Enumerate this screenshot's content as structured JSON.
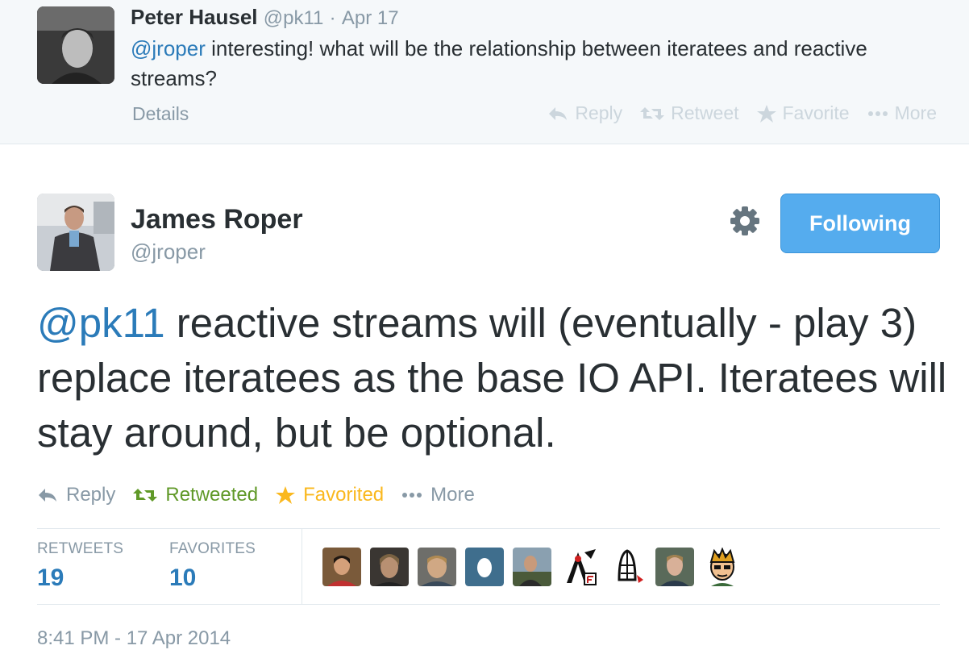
{
  "reply_tweet": {
    "name": "Peter Hausel",
    "handle": "@pk11",
    "separator": "·",
    "date": "Apr 17",
    "mention": "@jroper",
    "text": " interesting! what will be the relationship between iteratees and reactive streams?",
    "details_label": "Details",
    "actions": {
      "reply": "Reply",
      "retweet": "Retweet",
      "favorite": "Favorite",
      "more": "More"
    }
  },
  "main_tweet": {
    "name": "James Roper",
    "handle": "@jroper",
    "follow_label": "Following",
    "mention": "@pk11",
    "text": " reactive streams will (eventually - play 3) replace iteratees as the base IO API. Iteratees will stay around, but be optional.",
    "actions": {
      "reply": "Reply",
      "retweeted": "Retweeted",
      "favorited": "Favorited",
      "more": "More"
    },
    "stats": {
      "retweets_label": "RETWEETS",
      "retweets_count": "19",
      "favorites_label": "FAVORITES",
      "favorites_count": "10"
    },
    "timestamp": "8:41 PM - 17 Apr 2014"
  },
  "colors": {
    "link": "#2b7bb9",
    "follow_button": "#55acee",
    "retweeted": "#609928",
    "favorited": "#fab81e",
    "muted": "#8899a6"
  }
}
